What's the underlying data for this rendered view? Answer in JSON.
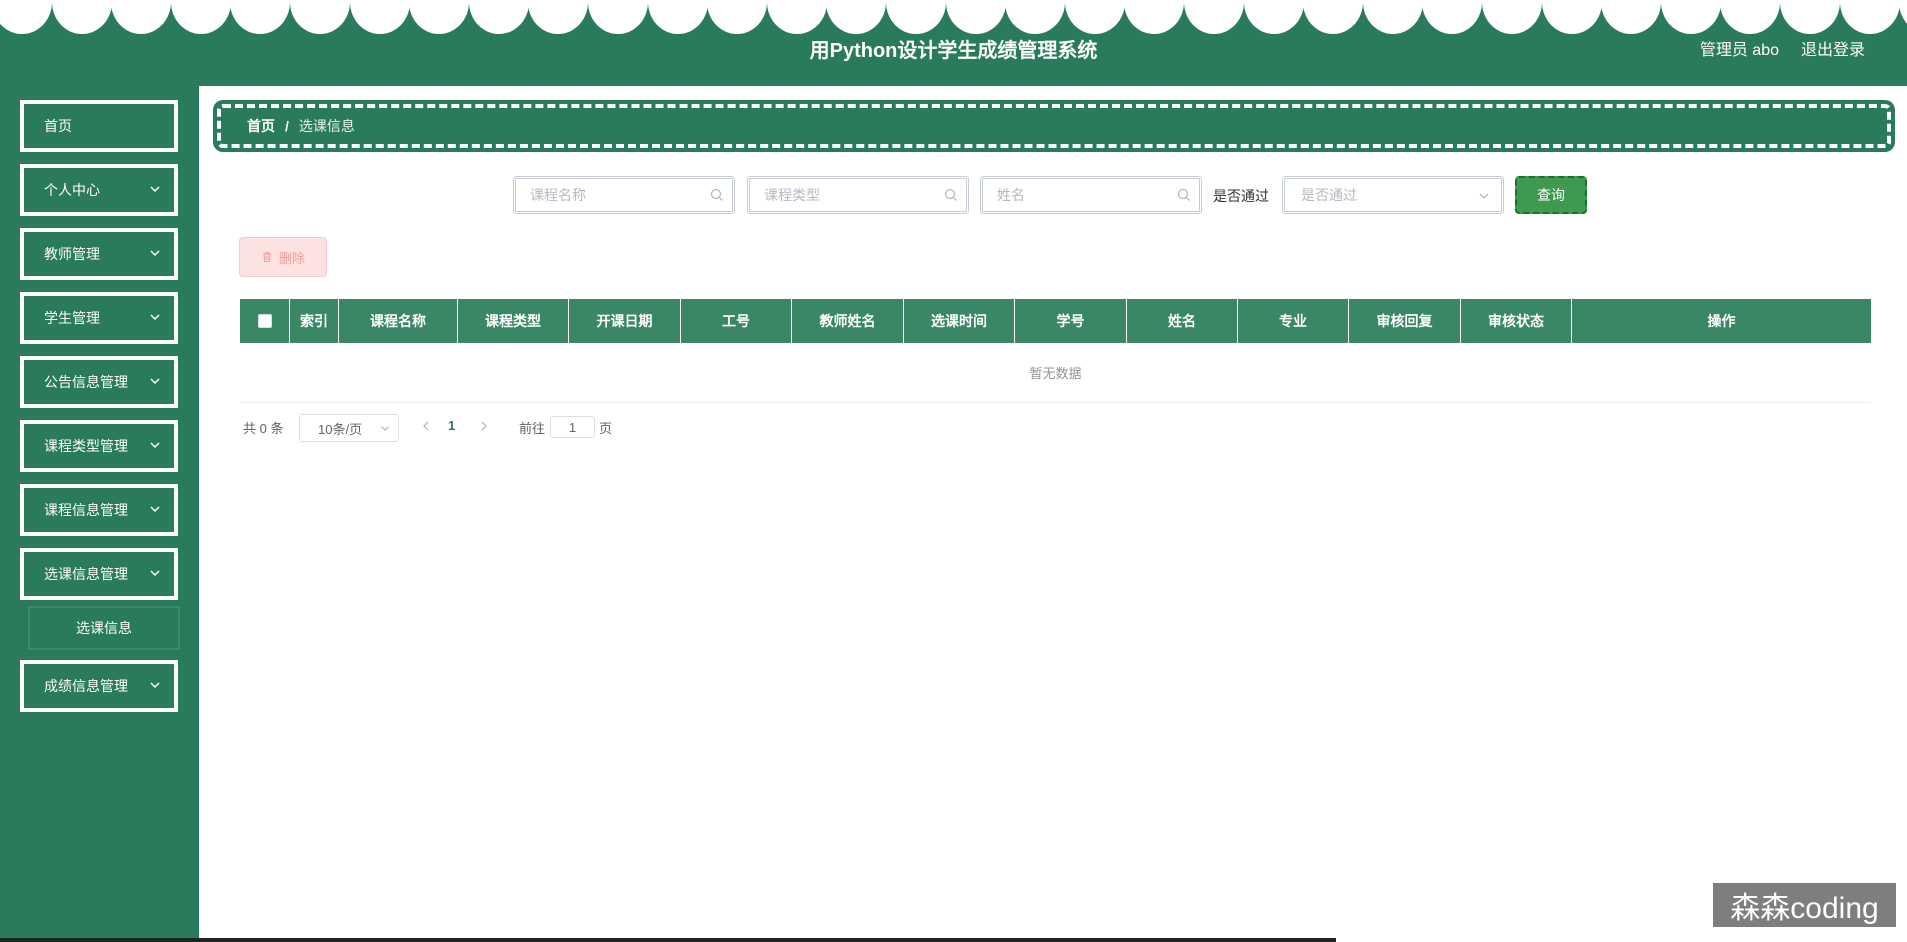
{
  "header": {
    "title": "用Python设计学生成绩管理系统",
    "user": "管理员 abo",
    "logout": "退出登录"
  },
  "sidebar": {
    "items": [
      {
        "label": "首页",
        "has_children": false
      },
      {
        "label": "个人中心",
        "has_children": true
      },
      {
        "label": "教师管理",
        "has_children": true
      },
      {
        "label": "学生管理",
        "has_children": true
      },
      {
        "label": "公告信息管理",
        "has_children": true
      },
      {
        "label": "课程类型管理",
        "has_children": true
      },
      {
        "label": "课程信息管理",
        "has_children": true
      },
      {
        "label": "选课信息管理",
        "has_children": true,
        "expanded": true
      },
      {
        "label": "成绩信息管理",
        "has_children": true
      }
    ],
    "submenu": {
      "label": "选课信息"
    }
  },
  "breadcrumb": {
    "home": "首页",
    "separator": "/",
    "current": "选课信息"
  },
  "search": {
    "course_name_placeholder": "课程名称",
    "course_type_placeholder": "课程类型",
    "name_placeholder": "姓名",
    "passed_label": "是否通过",
    "passed_placeholder": "是否通过",
    "query_button": "查询"
  },
  "toolbar": {
    "delete_button": "删除"
  },
  "table": {
    "columns": [
      "索引",
      "课程名称",
      "课程类型",
      "开课日期",
      "工号",
      "教师姓名",
      "选课时间",
      "学号",
      "姓名",
      "专业",
      "审核回复",
      "审核状态",
      "操作"
    ],
    "empty_text": "暂无数据"
  },
  "pagination": {
    "total": "共 0 条",
    "page_size": "10条/页",
    "current_page": "1",
    "goto_prefix": "前往",
    "goto_value": "1",
    "goto_suffix": "页"
  },
  "watermark": "森森coding",
  "colors": {
    "primary": "#2a7a5c",
    "table_header": "#3a8766",
    "query_button": "#3d9a4f",
    "delete_button_bg": "#fde2e2"
  }
}
